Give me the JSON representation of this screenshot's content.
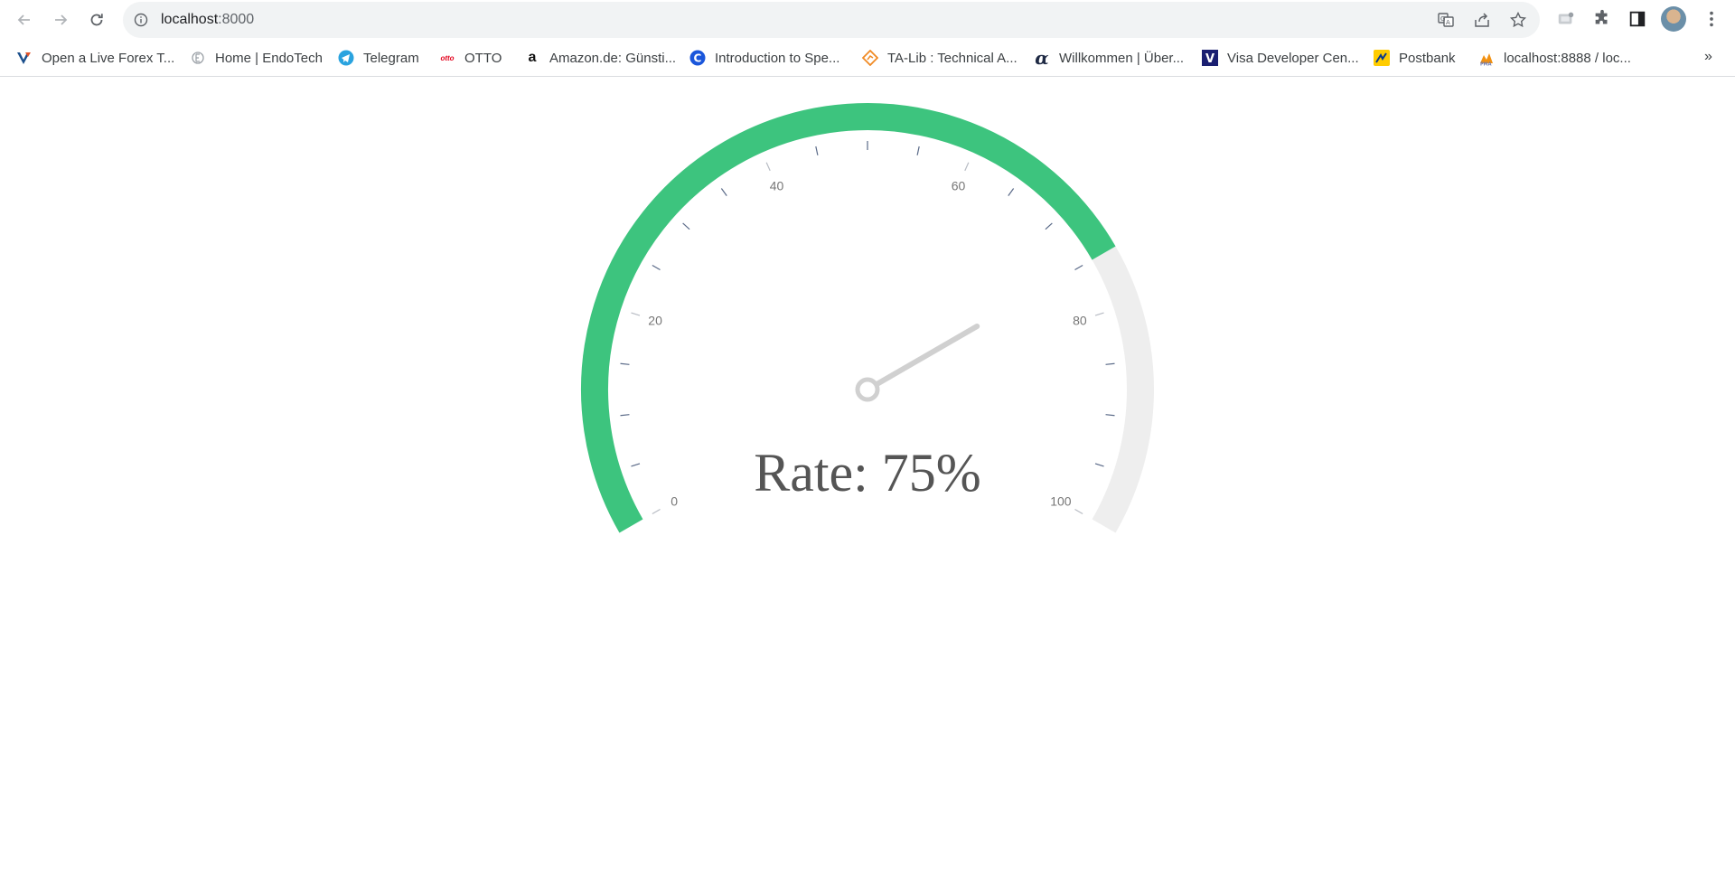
{
  "browser": {
    "url_host": "localhost",
    "url_port": ":8000",
    "bookmarks": [
      {
        "label": "Open a Live Forex T...",
        "icon": "vantage-icon",
        "color": "#1b4f8c"
      },
      {
        "label": "Home | EndoTech",
        "icon": "endotech-icon",
        "color": "#9aa0a6"
      },
      {
        "label": "Telegram",
        "icon": "telegram-icon",
        "color": "#2aa3df"
      },
      {
        "label": "OTTO",
        "icon": "otto-icon",
        "color": "#e3001b"
      },
      {
        "label": "Amazon.de: Günsti...",
        "icon": "amazon-icon",
        "color": "#111111"
      },
      {
        "label": "Introduction to Spe...",
        "icon": "c-icon",
        "color": "#1a56db"
      },
      {
        "label": "TA-Lib : Technical A...",
        "icon": "talib-icon",
        "color": "#f08a24"
      },
      {
        "label": "Willkommen | Über...",
        "icon": "alpha-icon",
        "color": "#1f2a44"
      },
      {
        "label": "Visa Developer Cen...",
        "icon": "visa-icon",
        "color": "#1a1f71"
      },
      {
        "label": "Postbank",
        "icon": "postbank-icon",
        "color": "#ffcc00"
      },
      {
        "label": "localhost:8888 / loc...",
        "icon": "phpmyadmin-icon",
        "color": "#f29111"
      }
    ]
  },
  "gauge": {
    "value": 75,
    "min": 0,
    "max": 100,
    "title": "Rate: 75%",
    "tick_labels": [
      "0",
      "20",
      "40",
      "60",
      "80",
      "100"
    ],
    "colors": {
      "progress": "#3dc47e",
      "track": "#eeeeee",
      "needle": "#d0d0d0",
      "tick": "#5a6a88",
      "label": "#777777",
      "title": "#555555"
    }
  }
}
